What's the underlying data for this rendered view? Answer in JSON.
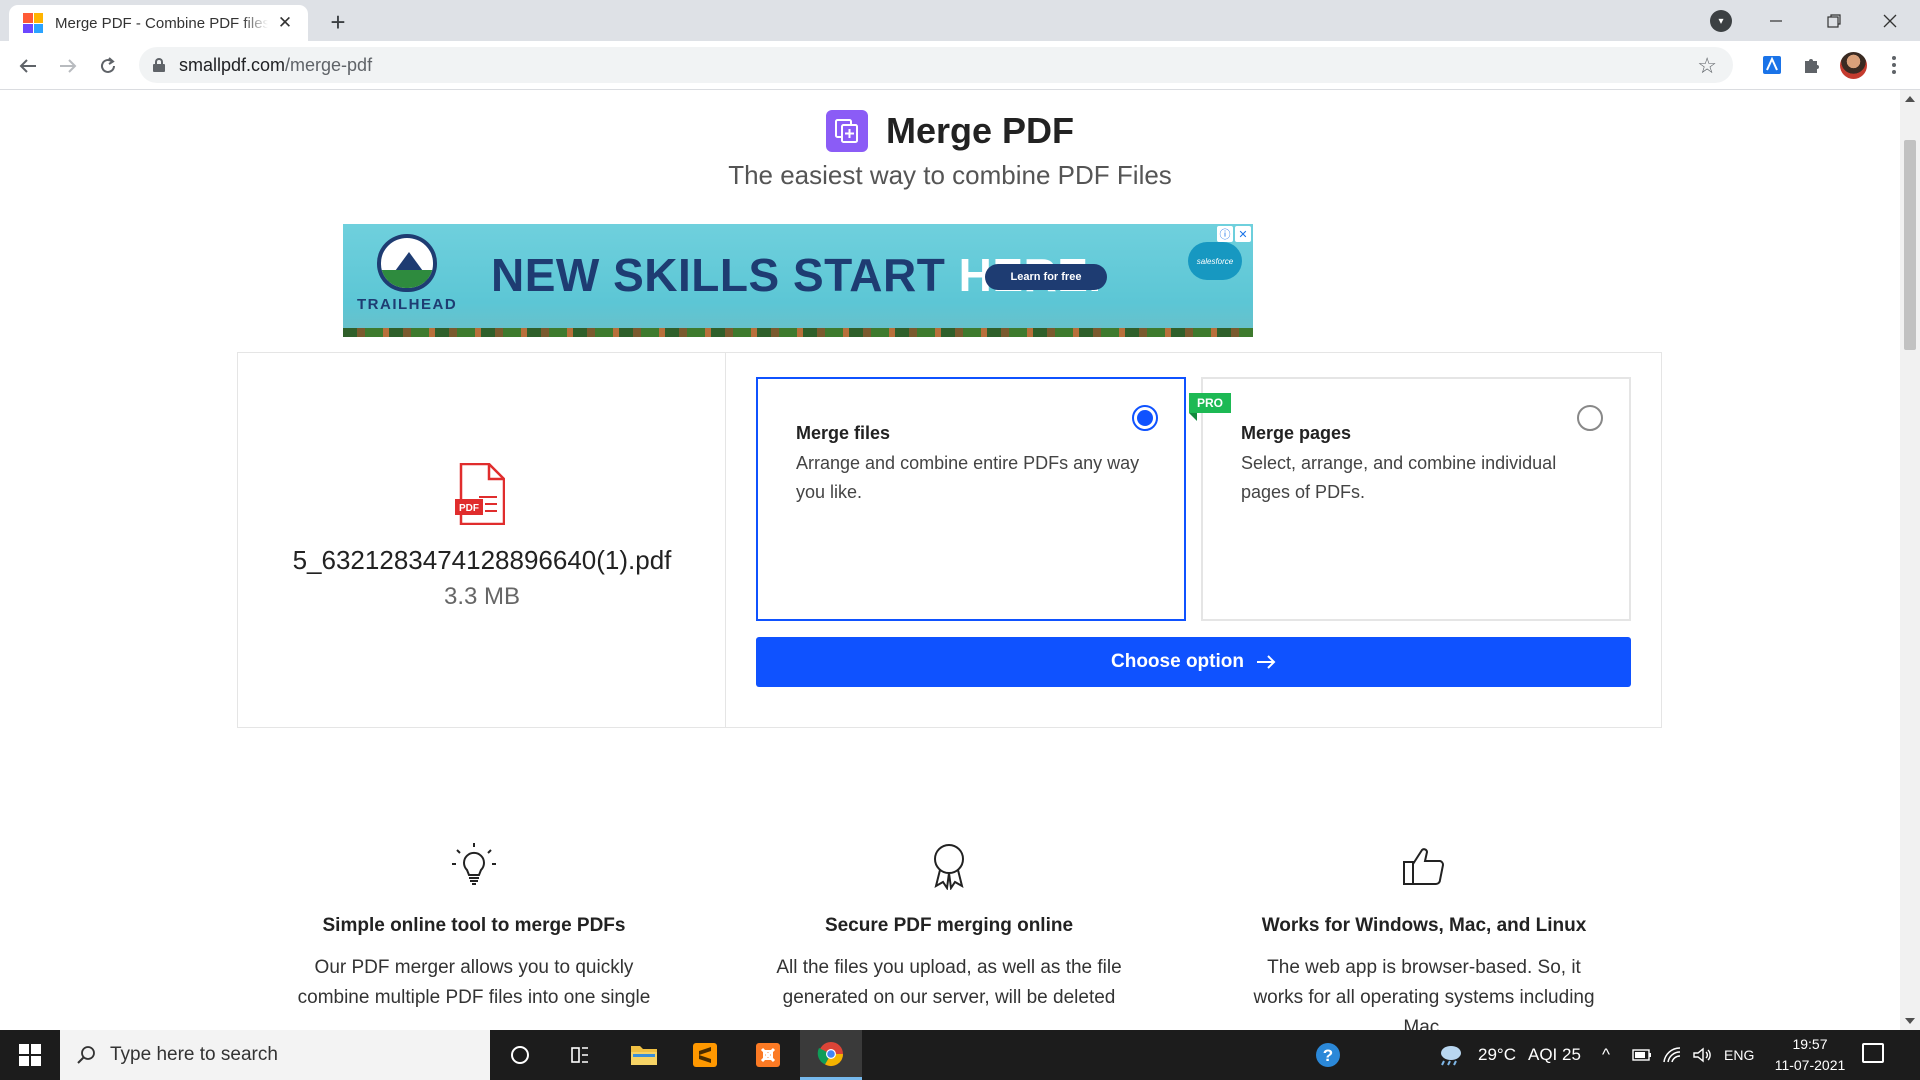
{
  "browser": {
    "tab_title": "Merge PDF - Combine PDF files online",
    "url_host": "smallpdf.com",
    "url_path": "/merge-pdf",
    "accent": "#dee1e6"
  },
  "hero": {
    "title": "Merge PDF",
    "subtitle": "The easiest way to combine PDF Files",
    "icon": "merge-pdf-icon",
    "icon_color": "#8b5cf6"
  },
  "ad": {
    "brand": "TRAILHEAD",
    "headline_main": "NEW SKILLS START ",
    "headline_accent": "HERE.",
    "cta": "Learn for free",
    "sponsor": "salesforce"
  },
  "file": {
    "name": "5_6321283474128896640(1).pdf",
    "size": "3.3 MB",
    "icon_label": "PDF"
  },
  "options": [
    {
      "title": "Merge files",
      "description": "Arrange and combine entire PDFs any way you like.",
      "selected": true
    },
    {
      "title": "Merge pages",
      "description": "Select, arrange, and combine individual pages of PDFs.",
      "selected": false,
      "badge": "PRO"
    }
  ],
  "choose_button": "Choose option",
  "primary_color": "#0f52ff",
  "features": [
    {
      "icon": "lightbulb-icon",
      "title": "Simple online tool to merge PDFs",
      "text": "Our PDF merger allows you to quickly combine multiple PDF files into one single"
    },
    {
      "icon": "award-ribbon-icon",
      "title": "Secure PDF merging online",
      "text": "All the files you upload, as well as the file generated on our server, will be deleted"
    },
    {
      "icon": "thumbs-up-icon",
      "title": "Works for Windows, Mac, and Linux",
      "text": "The web app is browser-based. So, it works for all operating systems including Mac,"
    }
  ],
  "taskbar": {
    "search_placeholder": "Type here to search",
    "weather": "29°C",
    "aqi": "AQI 25",
    "language": "ENG",
    "time": "19:57",
    "date": "11-07-2021"
  }
}
